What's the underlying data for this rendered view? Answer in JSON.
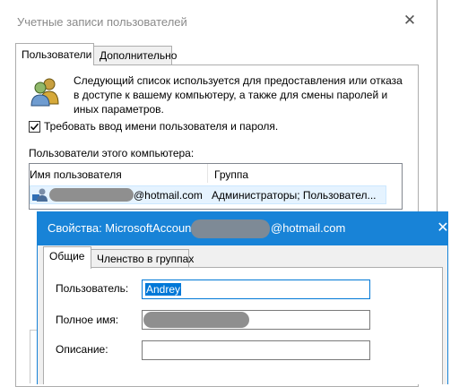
{
  "back_window": {
    "title": "Учетные записи пользователей",
    "tabs": [
      "Пользователи",
      "Дополнительно"
    ],
    "intro_text": "Следующий список используется для предоставления или отказа в доступе к вашему компьютеру, а также для смены паролей и иных параметров.",
    "require_login": {
      "label": "Требовать ввод имени пользователя и пароля.",
      "checked": true
    },
    "users_heading": "Пользователи этого компьютера:",
    "columns": [
      "Имя пользователя",
      "Группа"
    ],
    "rows": [
      {
        "username_suffix": "@hotmail.com",
        "group": "Администраторы; Пользовател..."
      }
    ]
  },
  "front_dialog": {
    "title_prefix": "Свойства: MicrosoftAccount\\",
    "title_suffix": "@hotmail.com",
    "tabs": [
      "Общие",
      "Членство в группах"
    ],
    "fields": {
      "user_label": "Пользователь:",
      "user_value": "Andrey",
      "fullname_label": "Полное имя:",
      "description_label": "Описание:",
      "description_value": ""
    }
  },
  "colors": {
    "accent": "#1883d7",
    "selection": "#0078d7"
  }
}
